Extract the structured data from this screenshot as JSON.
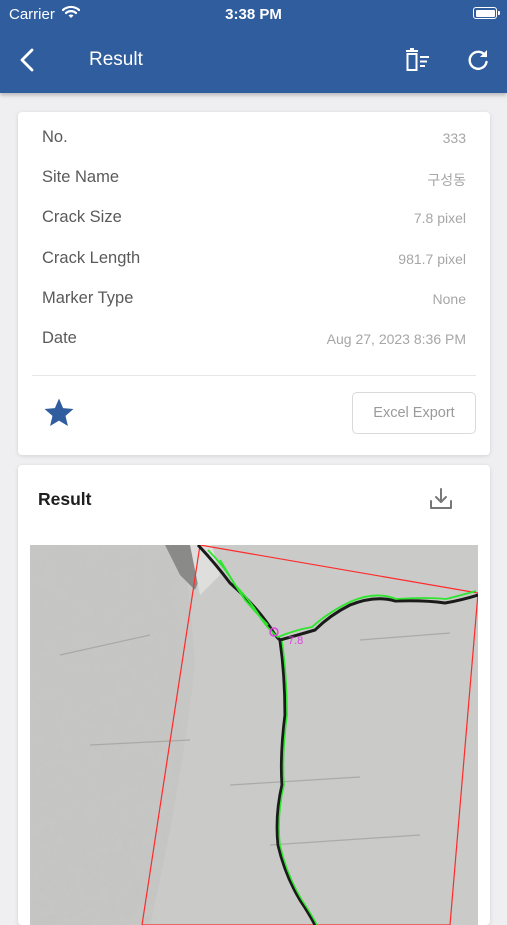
{
  "status_bar": {
    "carrier": "Carrier",
    "time": "3:38 PM"
  },
  "nav": {
    "title": "Result",
    "back_icon": "chevron-left-icon",
    "delete_icon": "delete-list-icon",
    "refresh_icon": "refresh-icon"
  },
  "info": {
    "rows": [
      {
        "label": "No.",
        "value": "333"
      },
      {
        "label": "Site Name",
        "value": "구성동"
      },
      {
        "label": "Crack Size",
        "value": "7.8 pixel"
      },
      {
        "label": "Crack Length",
        "value": "981.7 pixel"
      },
      {
        "label": "Marker Type",
        "value": "None"
      },
      {
        "label": "Date",
        "value": "Aug 27, 2023 8:36 PM"
      }
    ],
    "favorite_icon": "star-icon",
    "export_label": "Excel Export"
  },
  "result": {
    "title": "Result",
    "download_icon": "download-icon",
    "overlay_label": "7.8"
  },
  "colors": {
    "primary": "#2f5d9e",
    "crack_overlay": "#2ee62e",
    "bbox": "#ff2a2a",
    "marker": "#e040e0"
  }
}
